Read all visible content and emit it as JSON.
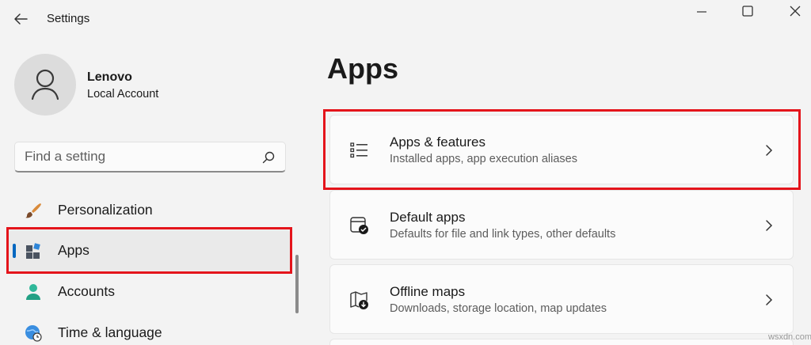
{
  "window": {
    "title": "Settings"
  },
  "user": {
    "name": "Lenovo",
    "account_type": "Local Account"
  },
  "search": {
    "placeholder": "Find a setting"
  },
  "sidebar": {
    "items": [
      {
        "label": "Personalization",
        "icon": "paint-brush-icon",
        "selected": false
      },
      {
        "label": "Apps",
        "icon": "apps-icon",
        "selected": true
      },
      {
        "label": "Accounts",
        "icon": "person-icon",
        "selected": false
      },
      {
        "label": "Time & language",
        "icon": "globe-clock-icon",
        "selected": false
      }
    ]
  },
  "main": {
    "title": "Apps",
    "cards": [
      {
        "title": "Apps & features",
        "subtitle": "Installed apps, app execution aliases",
        "icon": "list-icon"
      },
      {
        "title": "Default apps",
        "subtitle": "Defaults for file and link types, other defaults",
        "icon": "default-apps-icon"
      },
      {
        "title": "Offline maps",
        "subtitle": "Downloads, storage location, map updates",
        "icon": "map-download-icon"
      }
    ]
  },
  "watermark": "wsxdn.com",
  "colors": {
    "highlight_border": "#e4141b",
    "accent": "#0067c0"
  }
}
